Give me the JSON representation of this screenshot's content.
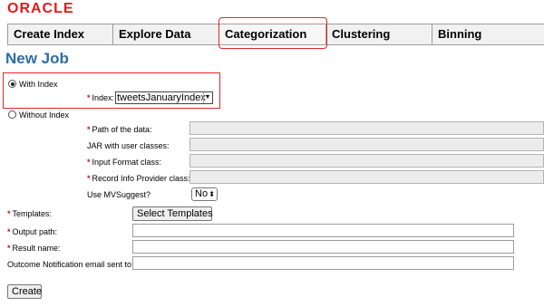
{
  "brand": {
    "logo_text": "ORACLE",
    "accent": "#e3191b"
  },
  "tabs": [
    {
      "label": "Create Index"
    },
    {
      "label": "Explore Data"
    },
    {
      "label": "Categorization"
    },
    {
      "label": "Clustering"
    },
    {
      "label": "Binning"
    }
  ],
  "page": {
    "title": "New Job",
    "title_color": "#2f6da3"
  },
  "form": {
    "with_index_label": "With Index",
    "without_index_label": "Without Index",
    "index_label": "Index:",
    "index_value": "tweetsJanuaryIndex",
    "path_label": "Path of the data:",
    "jar_label": "JAR with user classes:",
    "input_format_label": "Input Format class:",
    "record_info_label": "Record Info Provider class:",
    "mvsuggest_label": "Use MVSuggest?",
    "mvsuggest_value": "No",
    "templates_label": "Templates:",
    "select_templates_button": "Select Templates",
    "output_path_label": "Output path:",
    "result_name_label": "Result name:",
    "email_label": "Outcome Notification email sent to:",
    "create_button": "Create",
    "required_marker": "*"
  }
}
